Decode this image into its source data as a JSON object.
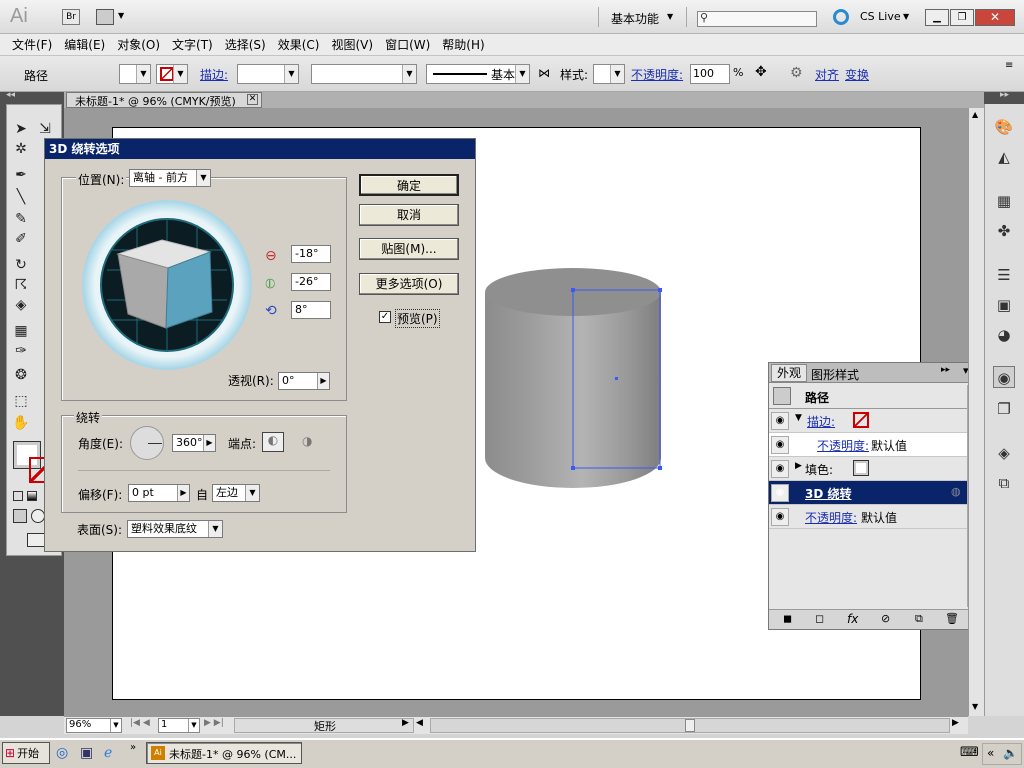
{
  "app": {
    "logo": "Ai",
    "bridge": "Br",
    "workspace": "基本功能",
    "cslive": "CS Live",
    "search_placeholder": ""
  },
  "menu": [
    "文件(F)",
    "编辑(E)",
    "对象(O)",
    "文字(T)",
    "选择(S)",
    "效果(C)",
    "视图(V)",
    "窗口(W)",
    "帮助(H)"
  ],
  "control": {
    "object": "路径",
    "stroke_label": "描边:",
    "brush": "基本",
    "style_label": "样式:",
    "opacity_label": "不透明度:",
    "opacity_value": "100",
    "percent": "%",
    "align": "对齐",
    "transform": "变换"
  },
  "doc_tab": "未标题-1* @ 96% (CMYK/预览)",
  "dialog": {
    "title": "3D 绕转选项",
    "position_label": "位置(N):",
    "position_value": "离轴 - 前方",
    "rot_x": "-18°",
    "rot_y": "-26°",
    "rot_z": "8°",
    "perspective_label": "透视(R):",
    "perspective_value": "0°",
    "ok": "确定",
    "cancel": "取消",
    "map": "贴图(M)...",
    "more": "更多选项(O)",
    "preview": "预览(P)",
    "revolve_group": "绕转",
    "angle_label": "角度(E):",
    "angle_value": "360°",
    "cap_label": "端点:",
    "offset_label": "偏移(F):",
    "offset_value": "0 pt",
    "from_label": "自",
    "from_value": "左边",
    "surface_label": "表面(S):",
    "surface_value": "塑料效果底纹"
  },
  "appearance": {
    "tab1": "外观",
    "tab2": "图形样式",
    "title": "路径",
    "rows": [
      {
        "label": "描边:",
        "type": "stroke"
      },
      {
        "label": "不透明度:",
        "value": "默认值",
        "type": "sub"
      },
      {
        "label": "填色:",
        "type": "fill"
      },
      {
        "label": "3D 绕转",
        "type": "effect"
      },
      {
        "label": "不透明度:",
        "value": "默认值",
        "type": "opacity"
      }
    ]
  },
  "status": {
    "zoom": "96%",
    "page": "1",
    "tool": "矩形"
  },
  "taskbar": {
    "start": "开始",
    "task": "未标题-1* @ 96% (CM..."
  },
  "colors": {
    "dialog_title": "#0a246a",
    "selection": "#3a5af0",
    "effect_row": "#0a246a"
  }
}
